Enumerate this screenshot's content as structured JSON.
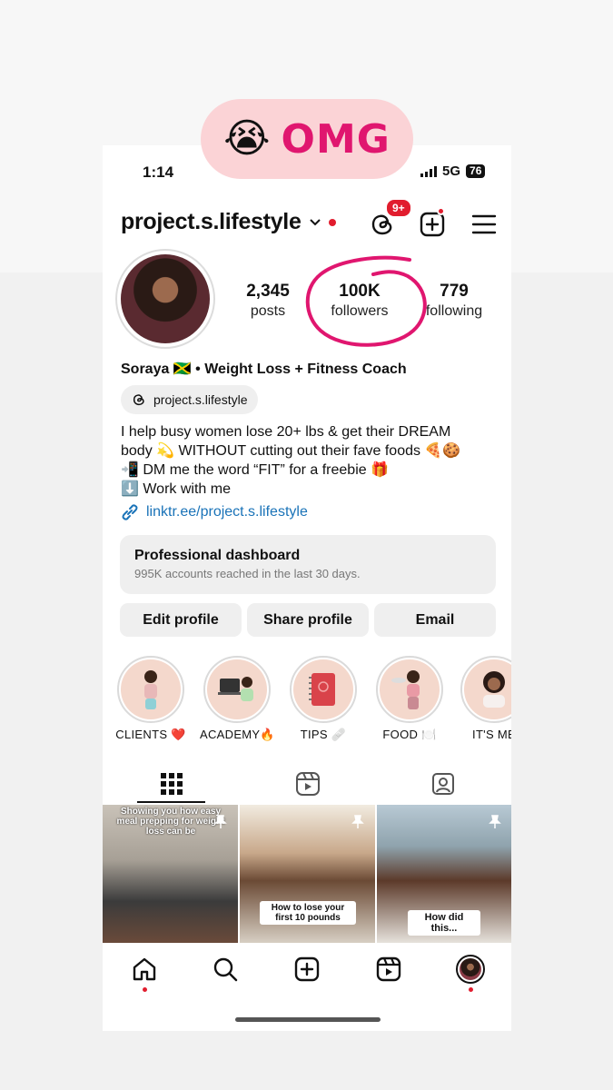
{
  "overlay": {
    "emoji": "😭",
    "text": "OMG"
  },
  "status": {
    "time": "1:14",
    "network": "5G",
    "battery": "76"
  },
  "header": {
    "username": "project.s.lifestyle",
    "badge": "9+"
  },
  "stats": [
    {
      "value": "2,345",
      "label": "posts"
    },
    {
      "value": "100K",
      "label": "followers"
    },
    {
      "value": "779",
      "label": "following"
    }
  ],
  "bio": {
    "name_line": "Soraya 🇯🇲 • Weight Loss + Fitness Coach",
    "threads_handle": "project.s.lifestyle",
    "lines": [
      "I help busy women lose 20+ lbs & get their DREAM",
      "body 💫 WITHOUT cutting out their fave foods 🍕🍪",
      "📲 DM me the word “FIT” for a freebie 🎁",
      "⬇️ Work with me"
    ],
    "link": "linktr.ee/project.s.lifestyle"
  },
  "dashboard": {
    "title": "Professional dashboard",
    "subtitle": "995K accounts reached in the last 30 days."
  },
  "buttons": {
    "edit": "Edit profile",
    "share": "Share profile",
    "email": "Email"
  },
  "highlights": [
    {
      "label": "CLIENTS ❤️"
    },
    {
      "label": "ACADEMY🔥"
    },
    {
      "label": "TIPS 🩹"
    },
    {
      "label": "FOOD 🍽️"
    },
    {
      "label": "IT'S ME"
    }
  ],
  "posts": [
    {
      "caption": "Showing you how easy meal prepping for weight loss can be"
    },
    {
      "caption": "How to lose your first 10 pounds"
    },
    {
      "caption": "How did this..."
    }
  ],
  "colors": {
    "accent": "#e0166f",
    "notification": "#e11d2e",
    "link": "#1a73b8",
    "pill": "#fbd3d6"
  }
}
